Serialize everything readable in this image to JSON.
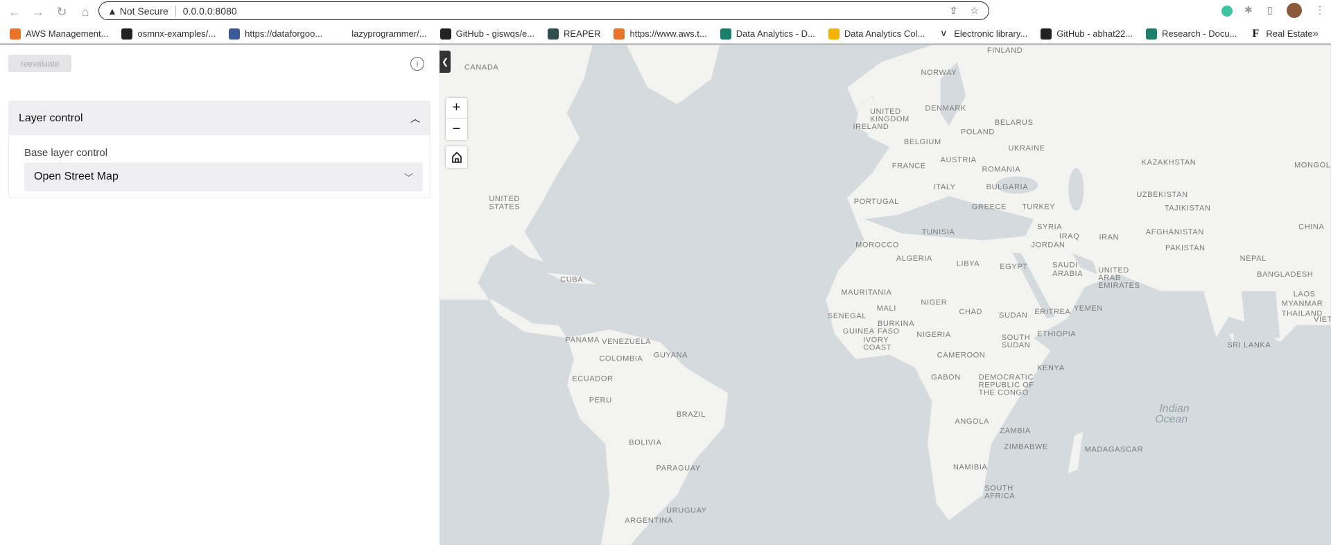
{
  "browser": {
    "security": "Not Secure",
    "url": "0.0.0.0:8080"
  },
  "bookmarks": [
    {
      "label": "AWS Management...",
      "icon": "aws-icon",
      "color": "#e8742c"
    },
    {
      "label": "osmnx-examples/...",
      "icon": "github-icon",
      "color": "#222"
    },
    {
      "label": "https://dataforgoo...",
      "icon": "facebook-icon",
      "color": "#3b5998"
    },
    {
      "label": "lazyprogrammer/...",
      "icon": "blank-icon",
      "color": "#fff"
    },
    {
      "label": "GitHub - giswqs/e...",
      "icon": "github-icon",
      "color": "#222"
    },
    {
      "label": "REAPER",
      "icon": "reaper-icon",
      "color": "#2f4f4f"
    },
    {
      "label": "https://www.aws.t...",
      "icon": "aws-icon",
      "color": "#e8742c"
    },
    {
      "label": "Data Analytics - D...",
      "icon": "sharepoint-icon",
      "color": "#1b7f6b"
    },
    {
      "label": "Data Analytics Col...",
      "icon": "google-drive-icon",
      "color": "#f4b400"
    },
    {
      "label": "Electronic library...",
      "icon": "v-icon",
      "color": "#fff"
    },
    {
      "label": "GitHub - abhat22...",
      "icon": "github-icon",
      "color": "#222"
    },
    {
      "label": "Research - Docu...",
      "icon": "sharepoint-icon",
      "color": "#1b7f6b"
    },
    {
      "label": "Real Estate",
      "icon": "f-icon",
      "color": "#fff"
    }
  ],
  "panel": {
    "reevaluate": "reevaluate",
    "card_title": "Layer control",
    "base_label": "Base layer control",
    "base_value": "Open Street Map"
  },
  "map": {
    "controls": {
      "zoom_in": "+",
      "zoom_out": "−"
    },
    "labels": [
      [
        "CANADA",
        29,
        25
      ],
      [
        "FINLAND",
        645,
        5
      ],
      [
        "NORWAY",
        567,
        31
      ],
      [
        "UNITED",
        507,
        77
      ],
      [
        "KINGDOM",
        507,
        86
      ],
      [
        "DENMARK",
        572,
        73
      ],
      [
        "IRELAND",
        487,
        95
      ],
      [
        "BELARUS",
        654,
        90
      ],
      [
        "POLAND",
        614,
        101
      ],
      [
        "BELGIUM",
        547,
        113
      ],
      [
        "UKRAINE",
        670,
        120
      ],
      [
        "FRANCE",
        533,
        141
      ],
      [
        "AUSTRIA",
        590,
        134
      ],
      [
        "ROMANIA",
        639,
        145
      ],
      [
        "KAZAKHSTAN",
        827,
        137
      ],
      [
        "MONGOLIA",
        1007,
        140
      ],
      [
        "ITALY",
        582,
        166
      ],
      [
        "BULGARIA",
        644,
        166
      ],
      [
        "UZBEKISTAN",
        821,
        175
      ],
      [
        "PORTUGAL",
        488,
        183
      ],
      [
        "GREECE",
        627,
        189
      ],
      [
        "TURKEY",
        686,
        189
      ],
      [
        "TAJIKISTAN",
        854,
        191
      ],
      [
        "UNITED",
        58,
        180
      ],
      [
        "STATES",
        58,
        189
      ],
      [
        "CHINA",
        1012,
        213
      ],
      [
        "TUNISIA",
        568,
        219
      ],
      [
        "SYRIA",
        704,
        213
      ],
      [
        "IRAQ",
        730,
        224
      ],
      [
        "IRAN",
        777,
        225
      ],
      [
        "AFGHANISTAN",
        832,
        219
      ],
      [
        "MOROCCO",
        490,
        234
      ],
      [
        "JORDAN",
        697,
        234
      ],
      [
        "PAKISTAN",
        855,
        238
      ],
      [
        "ALGERIA",
        538,
        250
      ],
      [
        "LIBYA",
        609,
        256
      ],
      [
        "EGYPT",
        660,
        260
      ],
      [
        "SAUDI",
        722,
        258
      ],
      [
        "ARABIA",
        722,
        268
      ],
      [
        "NEPAL",
        943,
        250
      ],
      [
        "UNITED",
        776,
        264
      ],
      [
        "ARAB",
        776,
        273
      ],
      [
        "EMIRATES",
        776,
        282
      ],
      [
        "BANGLADESH",
        963,
        269
      ],
      [
        "CUBA",
        142,
        275
      ],
      [
        "MAURITANIA",
        473,
        290
      ],
      [
        "MALI",
        515,
        309
      ],
      [
        "NIGER",
        567,
        302
      ],
      [
        "CHAD",
        612,
        313
      ],
      [
        "SUDAN",
        659,
        317
      ],
      [
        "ERITREA",
        701,
        313
      ],
      [
        "YEMEN",
        747,
        309
      ],
      [
        "MYANMAR",
        992,
        303
      ],
      [
        "LAOS",
        1006,
        292
      ],
      [
        "THAILAND",
        992,
        315
      ],
      [
        "VIETNAM",
        1030,
        322
      ],
      [
        "SENEGAL",
        457,
        318
      ],
      [
        "BURKINA",
        516,
        327
      ],
      [
        "FASO",
        516,
        336
      ],
      [
        "NIGERIA",
        562,
        340
      ],
      [
        "ETHIOPIA",
        704,
        339
      ],
      [
        "GUINEA",
        475,
        336
      ],
      [
        "SOUTH",
        662,
        343
      ],
      [
        "SUDAN",
        662,
        352
      ],
      [
        "PANAMA",
        148,
        346
      ],
      [
        "VENEZUELA",
        191,
        348
      ],
      [
        "IVORY",
        499,
        346
      ],
      [
        "COAST",
        499,
        355
      ],
      [
        "GUYANA",
        252,
        364
      ],
      [
        "COLOMBIA",
        188,
        368
      ],
      [
        "CAMEROON",
        586,
        364
      ],
      [
        "SRI LANKA",
        928,
        352
      ],
      [
        "KENYA",
        704,
        379
      ],
      [
        "ECUADOR",
        156,
        392
      ],
      [
        "GABON",
        579,
        390
      ],
      [
        "DEMOCRATIC",
        635,
        390
      ],
      [
        "REPUBLIC OF",
        635,
        399
      ],
      [
        "THE CONGO",
        635,
        408
      ],
      [
        "PERU",
        176,
        417
      ],
      [
        "BRAZIL",
        279,
        434
      ],
      [
        "ANGOLA",
        607,
        442
      ],
      [
        "ZAMBIA",
        660,
        453
      ],
      [
        "BOLIVIA",
        223,
        467
      ],
      [
        "ZIMBABWE",
        665,
        472
      ],
      [
        "MADAGASCAR",
        760,
        475
      ],
      [
        "PARAGUAY",
        255,
        497
      ],
      [
        "NAMIBIA",
        605,
        496
      ],
      [
        "SOUTH",
        642,
        521
      ],
      [
        "AFRICA",
        642,
        530
      ],
      [
        "URUGUAY",
        267,
        547
      ],
      [
        "ARGENTINA",
        218,
        559
      ]
    ],
    "ocean": [
      "Indian",
      "Ocean"
    ]
  }
}
